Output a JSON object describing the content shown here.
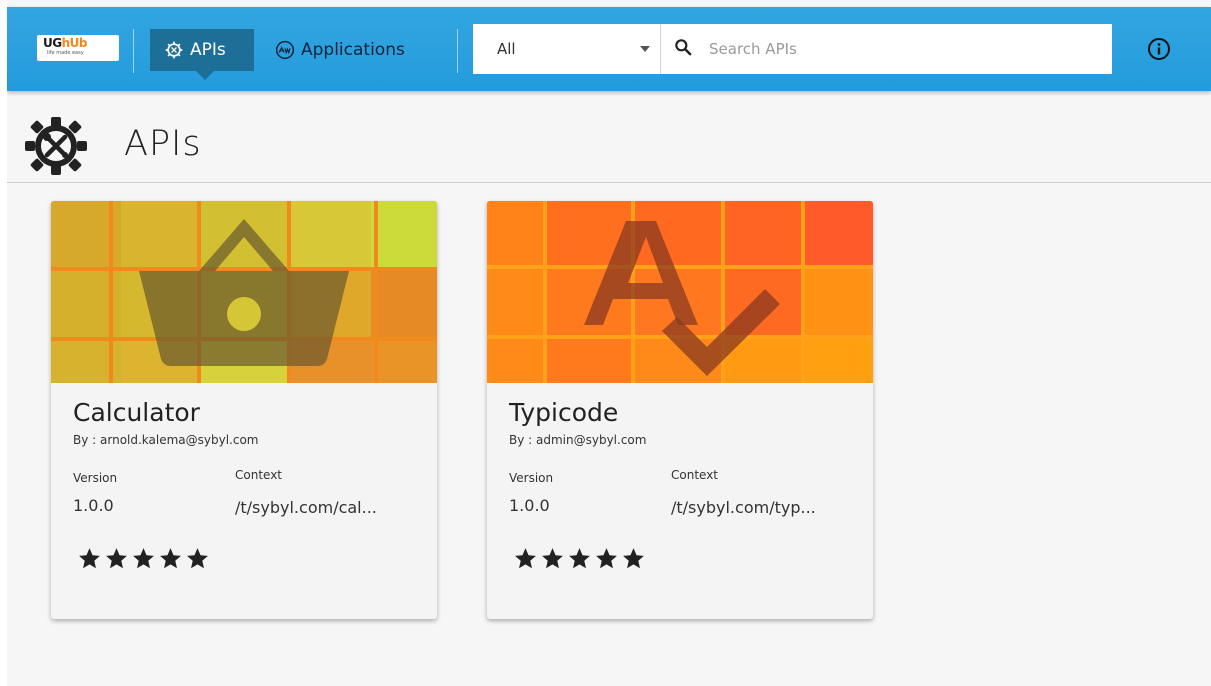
{
  "app": {
    "logo_text_main": "UG",
    "logo_text_accent": "hUb",
    "logo_tagline": "life made easy"
  },
  "nav": {
    "apis_label": "APIs",
    "applications_label": "Applications"
  },
  "search": {
    "filter_value": "All",
    "placeholder": "Search APIs"
  },
  "page": {
    "title": "APIs"
  },
  "cards": [
    {
      "name": "Calculator",
      "by": "By : arnold.kalema@sybyl.com",
      "version_label": "Version",
      "version": "1.0.0",
      "context_label": "Context",
      "context": "/t/sybyl.com/cal...",
      "rating": 5,
      "thumbnail_icon": "shopping-basket-icon"
    },
    {
      "name": "Typicode",
      "by": "By : admin@sybyl.com",
      "version_label": "Version",
      "version": "1.0.0",
      "context_label": "Context",
      "context": "/t/sybyl.com/typ...",
      "rating": 5,
      "thumbnail_icon": "spellcheck-icon"
    }
  ],
  "colors": {
    "topbar": "#239bdc",
    "nav_active": "#1e6f98",
    "card_bg": "#f4f4f4",
    "calculator_palette": [
      "#d4b32c",
      "#cddb3a",
      "#e68a26",
      "#f08a1c"
    ],
    "typicode_palette": [
      "#ff6a1e",
      "#ff8a18",
      "#ff5a2a",
      "#ffa010"
    ]
  }
}
